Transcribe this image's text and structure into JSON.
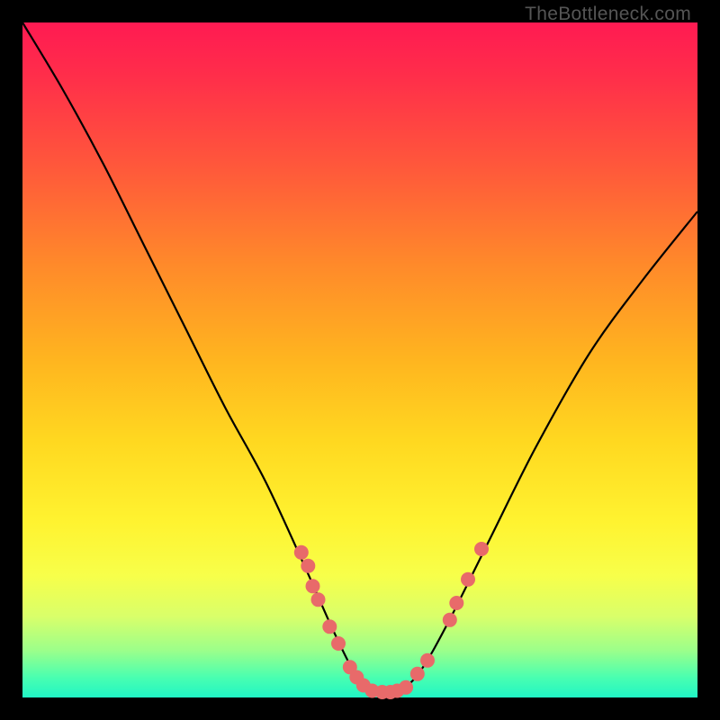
{
  "watermark": "TheBottleneck.com",
  "chart_data": {
    "type": "line",
    "title": "",
    "xlabel": "",
    "ylabel": "",
    "xlim": [
      0,
      100
    ],
    "ylim": [
      0,
      100
    ],
    "series": [
      {
        "name": "curve",
        "x": [
          0,
          6,
          12,
          18,
          24,
          30,
          36,
          42,
          46,
          49,
          51,
          54,
          56,
          59,
          63,
          69,
          76,
          84,
          92,
          100
        ],
        "y": [
          100,
          90,
          79,
          67,
          55,
          43,
          32,
          19,
          10,
          4,
          2,
          1,
          1,
          4,
          11,
          23,
          37,
          51,
          62,
          72
        ]
      }
    ],
    "markers": {
      "name": "scatter-along-bottom",
      "color": "#e86a6a",
      "radius": 8,
      "points": [
        {
          "x": 41.3,
          "y": 21.5
        },
        {
          "x": 42.3,
          "y": 19.5
        },
        {
          "x": 43.0,
          "y": 16.5
        },
        {
          "x": 43.8,
          "y": 14.5
        },
        {
          "x": 45.5,
          "y": 10.5
        },
        {
          "x": 46.8,
          "y": 8.0
        },
        {
          "x": 48.5,
          "y": 4.5
        },
        {
          "x": 49.5,
          "y": 3.0
        },
        {
          "x": 50.5,
          "y": 1.8
        },
        {
          "x": 51.8,
          "y": 1.0
        },
        {
          "x": 53.3,
          "y": 0.8
        },
        {
          "x": 54.5,
          "y": 0.8
        },
        {
          "x": 55.5,
          "y": 1.0
        },
        {
          "x": 56.8,
          "y": 1.5
        },
        {
          "x": 58.5,
          "y": 3.5
        },
        {
          "x": 60.0,
          "y": 5.5
        },
        {
          "x": 63.3,
          "y": 11.5
        },
        {
          "x": 64.3,
          "y": 14.0
        },
        {
          "x": 66.0,
          "y": 17.5
        },
        {
          "x": 68.0,
          "y": 22.0
        }
      ]
    }
  }
}
